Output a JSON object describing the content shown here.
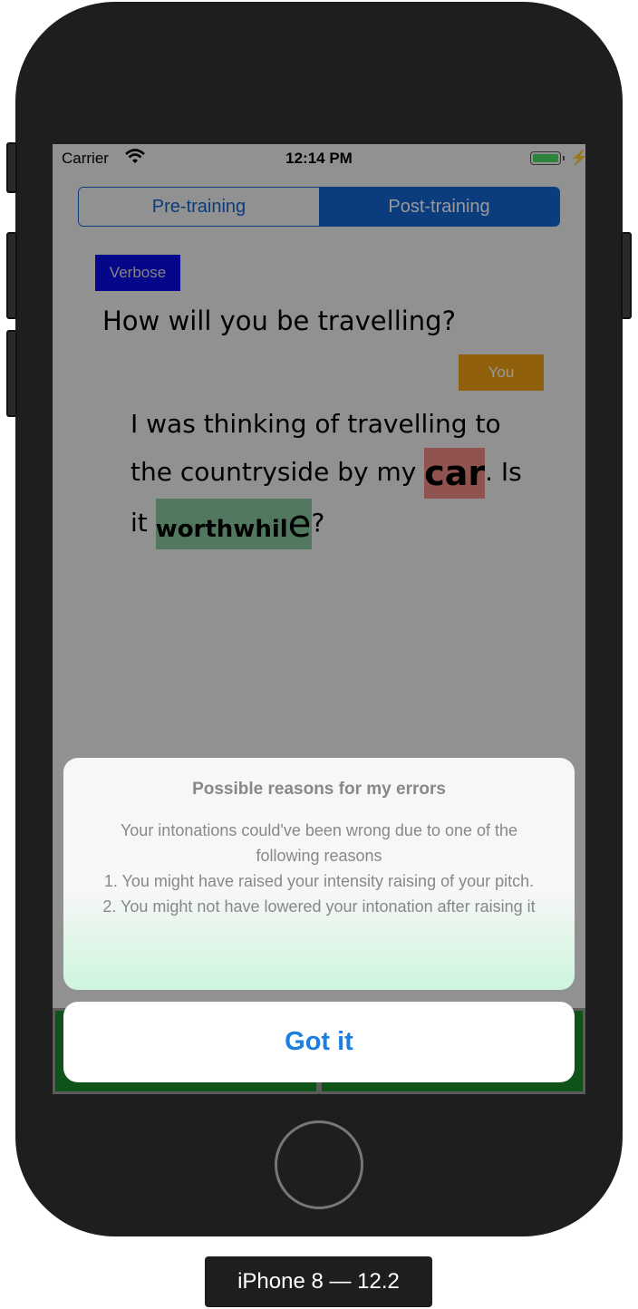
{
  "status": {
    "carrier": "Carrier",
    "time": "12:14 PM"
  },
  "segmented": {
    "left": "Pre-training",
    "right": "Post-training",
    "selected": "Post-training"
  },
  "conversation": {
    "speaker_label": "Verbose",
    "question": "How will you be travelling?",
    "user_label": "You",
    "answer": {
      "part1": "I was thinking of travelling to the countryside by my ",
      "word_car_a": "c",
      "word_car_b": "ar",
      "part2": ". Is it ",
      "word_worth_a": "worthwhil",
      "word_worth_b": "e",
      "part3": "?"
    }
  },
  "alert": {
    "title": "Possible reasons for my errors",
    "message": "Your intonations could've been wrong due to one of the following reasons\n1. You might have raised your intensity raising of your pitch.\n2. You might not have lowered your intonation after raising it",
    "button": "Got it"
  },
  "device_caption": "iPhone 8 — 12.2",
  "colors": {
    "accent": "#1364d1",
    "verbose_tag": "#0a0ae6",
    "you_tag": "#f0a016",
    "error_highlight": "#f08a84",
    "ok_highlight": "#8ac8a0",
    "alert_button": "#1a7fe0"
  }
}
